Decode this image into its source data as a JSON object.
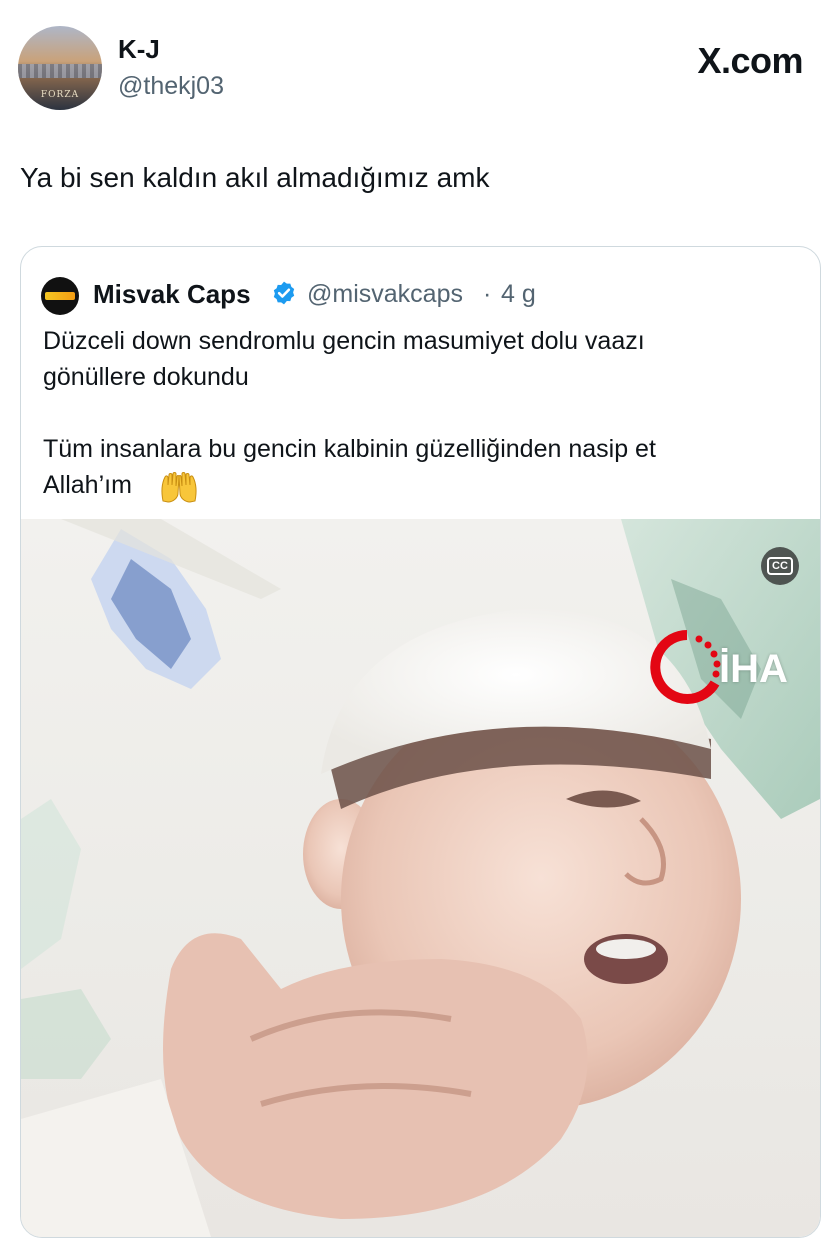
{
  "header": {
    "display_name": "K-J",
    "handle": "@thekj03",
    "brand": "X.com",
    "avatar_text": "FORZA"
  },
  "tweet": {
    "text": "Ya bi sen kaldın akıl almadığımız amk"
  },
  "quoted_tweet": {
    "display_name": "Misvak Caps",
    "handle": "@misvakcaps",
    "separator": "·",
    "time_ago": "4 g",
    "lines": [
      "Düzceli down sendromlu gencin masumiyet dolu vaazı",
      "gönüllere dokundu",
      "Tüm insanlara bu gencin kalbinin güzelliğinden nasip et",
      "Allah’ım"
    ],
    "emoji": "raising-hands-emoji",
    "verified_color": "#1d9bf0"
  },
  "media": {
    "cc_label": "CC",
    "watermark_text": "İHA",
    "watermark_color": "#e30613"
  },
  "icons": [
    "verified-badge-icon",
    "closed-captions-icon",
    "iha-logo-icon"
  ]
}
